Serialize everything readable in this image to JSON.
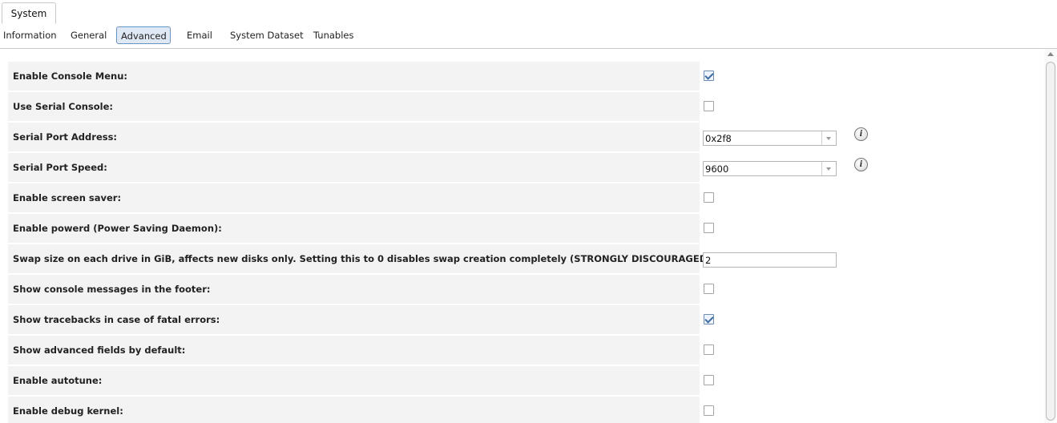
{
  "main_tab": {
    "label": "System"
  },
  "subtabs": [
    {
      "label": "Information"
    },
    {
      "label": "General"
    },
    {
      "label": "Advanced"
    },
    {
      "label": "Email"
    },
    {
      "label": "System Dataset"
    },
    {
      "label": "Tunables"
    }
  ],
  "active_subtab": "Advanced",
  "form": {
    "rows": [
      {
        "label": "Enable Console Menu:",
        "type": "checkbox",
        "checked": true
      },
      {
        "label": "Use Serial Console:",
        "type": "checkbox",
        "checked": false
      },
      {
        "label": "Serial Port Address:",
        "type": "select",
        "value": "0x2f8",
        "info_icon": "info-icon"
      },
      {
        "label": "Serial Port Speed:",
        "type": "select",
        "value": "9600",
        "info_icon": "info-icon"
      },
      {
        "label": "Enable screen saver:",
        "type": "checkbox",
        "checked": false
      },
      {
        "label": "Enable powerd (Power Saving Daemon):",
        "type": "checkbox",
        "checked": false
      },
      {
        "label": "Swap size on each drive in GiB, affects new disks only. Setting this to 0 disables swap creation completely (STRONGLY DISCOURAGED).",
        "type": "text",
        "value": "2"
      },
      {
        "label": "Show console messages in the footer:",
        "type": "checkbox",
        "checked": false
      },
      {
        "label": "Show tracebacks in case of fatal errors:",
        "type": "checkbox",
        "checked": true
      },
      {
        "label": "Show advanced fields by default:",
        "type": "checkbox",
        "checked": false
      },
      {
        "label": "Enable autotune:",
        "type": "checkbox",
        "checked": false
      },
      {
        "label": "Enable debug kernel:",
        "type": "checkbox",
        "checked": false
      }
    ]
  },
  "info_glyph": "i",
  "colors": {
    "active_tab_bg": "#dfe9f5",
    "active_tab_border": "#6a94c4",
    "row_bg": "#f3f3f3"
  }
}
